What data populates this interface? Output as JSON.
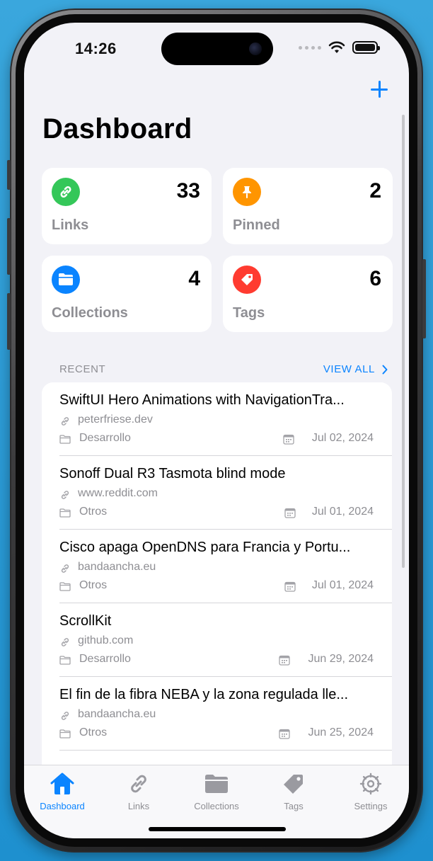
{
  "status_bar": {
    "time": "14:26"
  },
  "header": {
    "title": "Dashboard"
  },
  "stats": [
    {
      "label": "Links",
      "count": "33",
      "icon": "link-icon",
      "color": "#34c759"
    },
    {
      "label": "Pinned",
      "count": "2",
      "icon": "pin-icon",
      "color": "#ff9500"
    },
    {
      "label": "Collections",
      "count": "4",
      "icon": "folder-icon",
      "color": "#0a84ff"
    },
    {
      "label": "Tags",
      "count": "6",
      "icon": "tag-icon",
      "color": "#ff3b30"
    }
  ],
  "recent": {
    "header": "RECENT",
    "view_all": "VIEW ALL",
    "items": [
      {
        "title": "SwiftUI Hero Animations with NavigationTra...",
        "domain": "peterfriese.dev",
        "collection": "Desarrollo",
        "date": "Jul 02, 2024"
      },
      {
        "title": "Sonoff Dual R3 Tasmota blind mode",
        "domain": "www.reddit.com",
        "collection": "Otros",
        "date": "Jul 01, 2024"
      },
      {
        "title": "Cisco apaga OpenDNS para Francia y Portu...",
        "domain": "bandaancha.eu",
        "collection": "Otros",
        "date": "Jul 01, 2024"
      },
      {
        "title": "ScrollKit",
        "domain": "github.com",
        "collection": "Desarrollo",
        "date": "Jun 29, 2024"
      },
      {
        "title": "El fin de la fibra NEBA y la zona regulada lle...",
        "domain": "bandaancha.eu",
        "collection": "Otros",
        "date": "Jun 25, 2024"
      }
    ]
  },
  "tabbar": {
    "tabs": [
      {
        "label": "Dashboard",
        "icon": "house-icon",
        "active": true
      },
      {
        "label": "Links",
        "icon": "link-icon"
      },
      {
        "label": "Collections",
        "icon": "folder-icon"
      },
      {
        "label": "Tags",
        "icon": "tag-icon"
      },
      {
        "label": "Settings",
        "icon": "gear-icon"
      }
    ]
  },
  "colors": {
    "accent": "#0a84ff",
    "background": "#f2f2f7"
  }
}
